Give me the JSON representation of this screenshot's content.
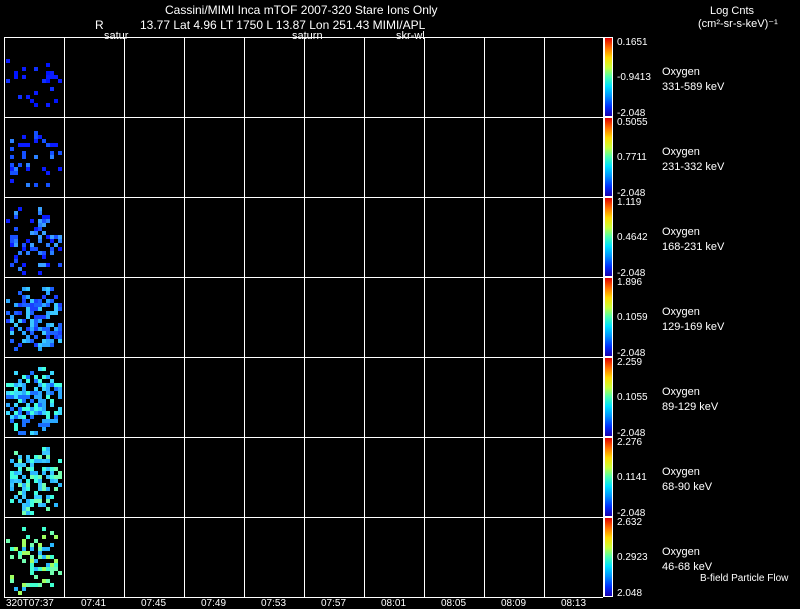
{
  "header": {
    "line1": "Cassini/MIMI Inca mTOF  2007-320   Stare    Ions Only",
    "line2_R": "R",
    "line2_rest": "13.77 Lat 4.96 LT 1750 L          13.87 Lon          251.43  MIMI/APL",
    "overlay_saturn_left": "satur",
    "overlay_saturn_mid": "saturn",
    "overlay_skr": "skr-wl",
    "units_title": "Log Cnts",
    "units_sub": "(cm²-sr-s-keV)⁻¹"
  },
  "panels": [
    {
      "max": "0.1651",
      "mid": "-0.9413",
      "min": "-2.048",
      "species": "Oxygen",
      "range": "331-589 keV"
    },
    {
      "max": "0.5055",
      "mid": "0.7711",
      "min": "-2.048",
      "species": "Oxygen",
      "range": "231-332 keV"
    },
    {
      "max": "1.119",
      "mid": "0.4642",
      "min": "-2.048",
      "species": "Oxygen",
      "range": "168-231 keV"
    },
    {
      "max": "1.896",
      "mid": "0.1059",
      "min": "-2.048",
      "species": "Oxygen",
      "range": "129-169 keV"
    },
    {
      "max": "2.259",
      "mid": "0.1055",
      "min": "-2.048",
      "species": "Oxygen",
      "range": "89-129 keV"
    },
    {
      "max": "2.276",
      "mid": "0.1141",
      "min": "-2.048",
      "species": "Oxygen",
      "range": "68-90 keV"
    },
    {
      "max": "2.632",
      "mid": "0.2923",
      "min": "2.048",
      "species": "Oxygen",
      "range": "46-68 keV"
    }
  ],
  "xaxis": {
    "ticks": [
      "320T07:37",
      "07:41",
      "07:45",
      "07:49",
      "07:53",
      "07:57",
      "08:01",
      "08:05",
      "08:09",
      "08:13"
    ]
  },
  "footer_label": "B-field Particle Flow",
  "colors": {
    "background": "#000000",
    "grid": "#ffffff",
    "pixel_low": "#0a1cff",
    "pixel_mid": "#2aa8ff",
    "pixel_high": "#3cffd6"
  }
}
